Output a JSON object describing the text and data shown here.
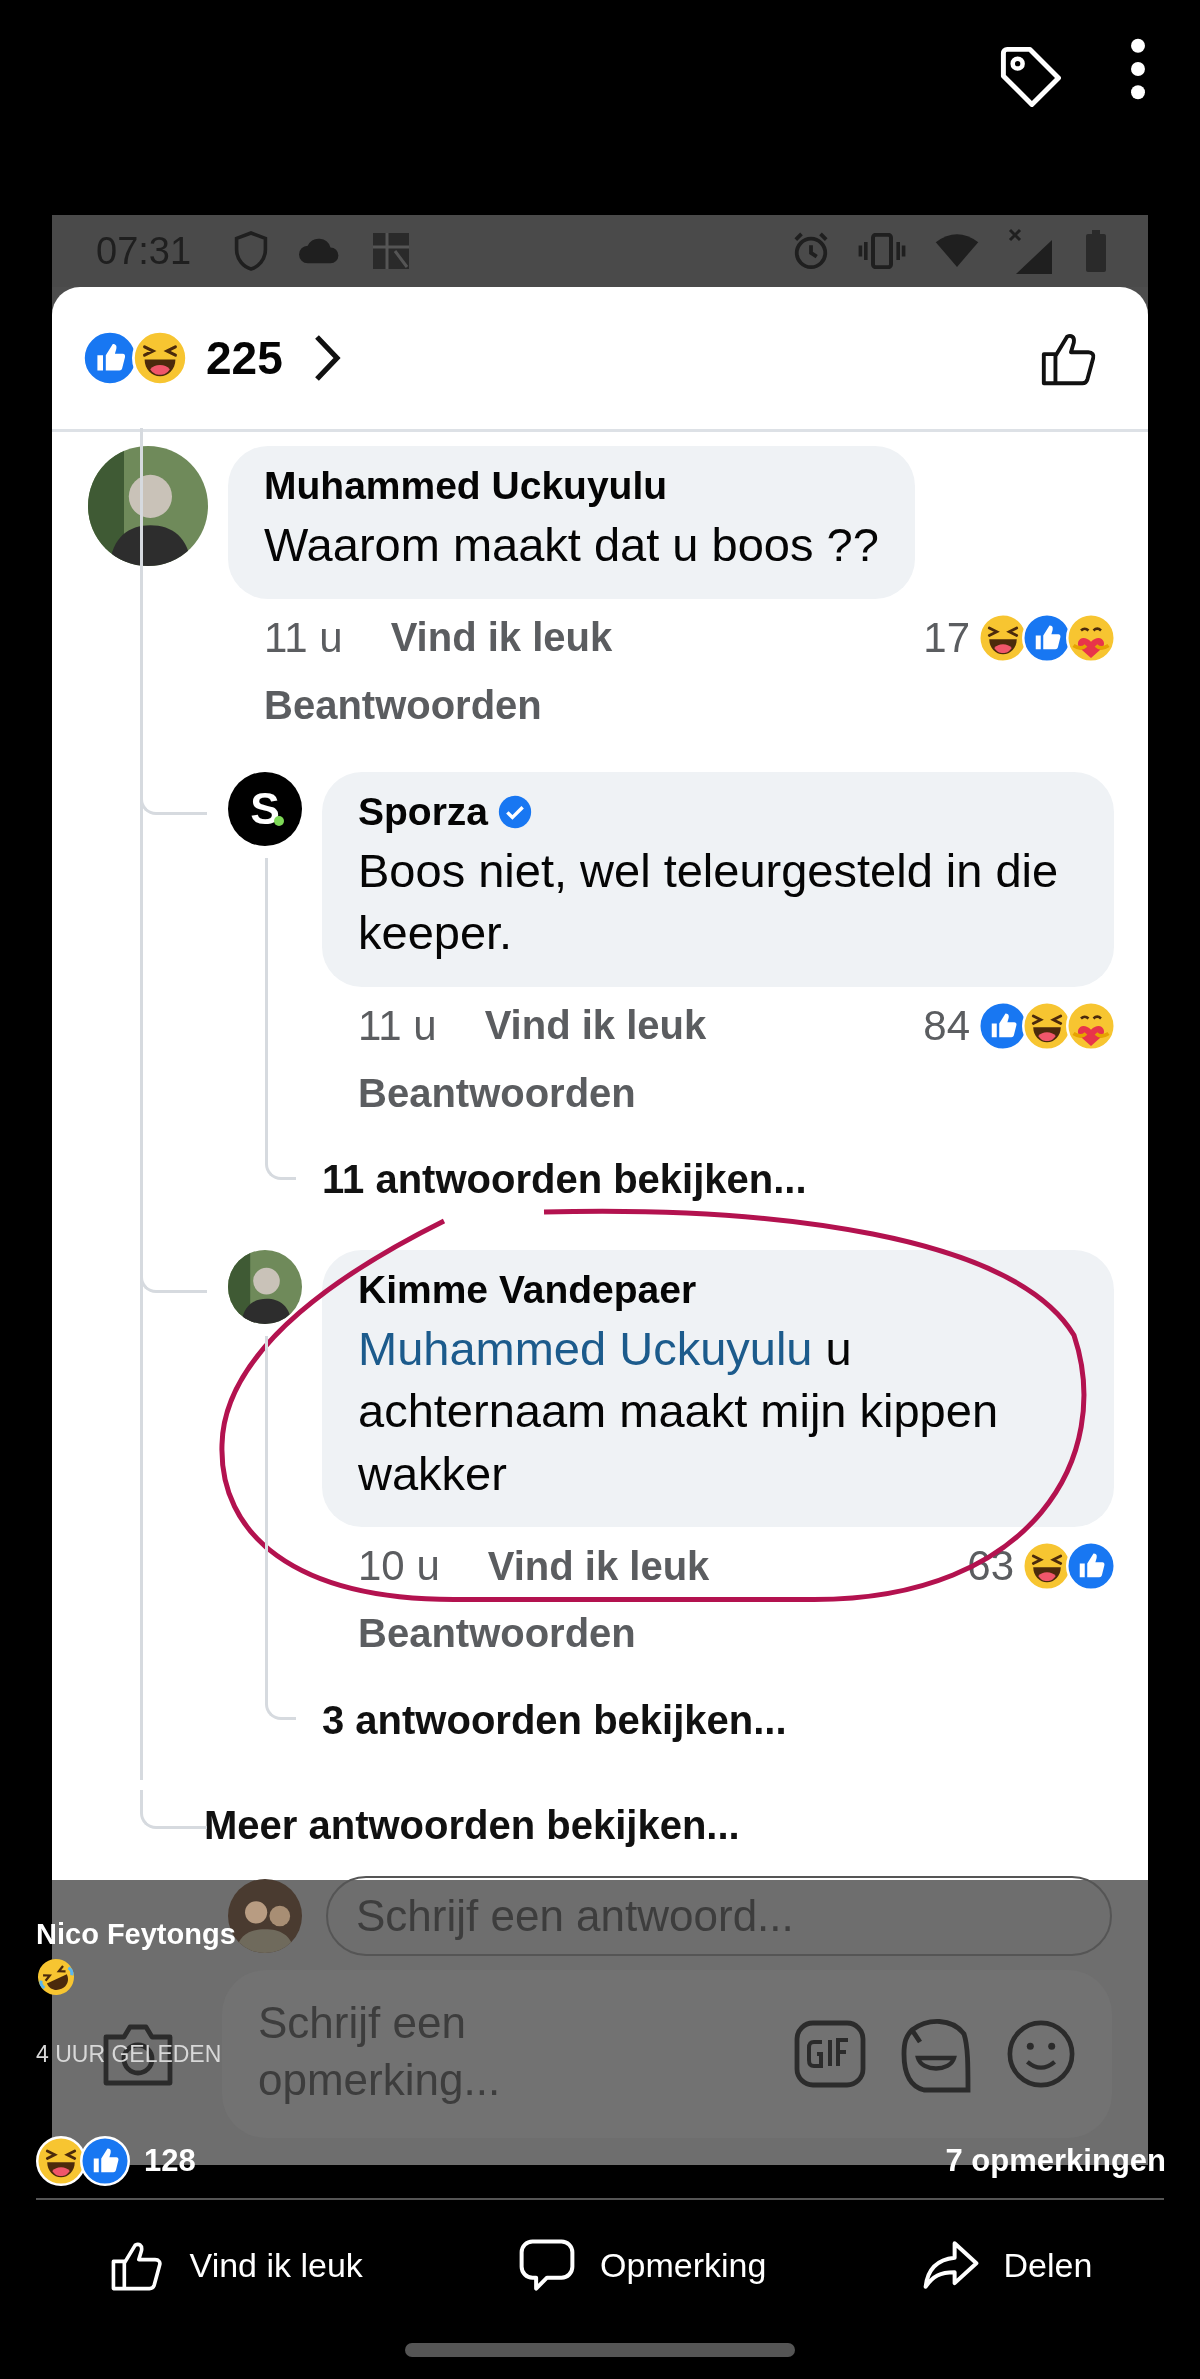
{
  "status_bar": {
    "time": "07:31"
  },
  "post_header": {
    "reactions": [
      {
        "kind": "like"
      },
      {
        "kind": "haha"
      }
    ],
    "reaction_count": "225"
  },
  "comments": [
    {
      "author": "Muhammed Uckuyulu",
      "verified": false,
      "avatar": {
        "kind": "photo"
      },
      "text": "Waarom maakt dat u boos ??",
      "time": "11 u",
      "like_label": "Vind ik leuk",
      "reply_label": "Beantwoorden",
      "reaction_count": "17",
      "reactions": [
        {
          "kind": "haha"
        },
        {
          "kind": "like"
        },
        {
          "kind": "care"
        }
      ],
      "more_replies": "Meer antwoorden bekijken...",
      "replies": [
        {
          "author": "Sporza",
          "verified": true,
          "avatar": {
            "kind": "logo",
            "text": "S"
          },
          "text": "Boos niet, wel teleurgesteld in die keeper.",
          "time": "11 u",
          "like_label": "Vind ik leuk",
          "reply_label": "Beantwoorden",
          "reaction_count": "84",
          "reactions": [
            {
              "kind": "like"
            },
            {
              "kind": "haha"
            },
            {
              "kind": "care"
            }
          ],
          "more_replies": "11 antwoorden bekijken..."
        },
        {
          "author": "Kimme Vandepaer",
          "verified": false,
          "annotated": true,
          "avatar": {
            "kind": "photo"
          },
          "mention": "Muhammed Uckuyulu",
          "text": "u achternaam maakt mijn kippen wakker",
          "time": "10 u",
          "like_label": "Vind ik leuk",
          "reply_label": "Beantwoorden",
          "reaction_count": "63",
          "reactions": [
            {
              "kind": "haha"
            },
            {
              "kind": "like"
            }
          ],
          "more_replies": "3 antwoorden bekijken..."
        }
      ]
    }
  ],
  "reply_field": {
    "placeholder": "Schrijf een antwoord..."
  },
  "comment_field": {
    "placeholder": "Schrijf een opmerking..."
  },
  "caption": {
    "author": "Nico Feytongs",
    "time": "4 UUR GELEDEN",
    "reactions": [
      {
        "kind": "haha"
      },
      {
        "kind": "like"
      }
    ],
    "reaction_count": "128",
    "comment_count": "7 opmerkingen"
  },
  "actions": [
    {
      "kind": "like",
      "label": "Vind ik leuk"
    },
    {
      "kind": "comment",
      "label": "Opmerking"
    },
    {
      "kind": "share",
      "label": "Delen"
    }
  ]
}
